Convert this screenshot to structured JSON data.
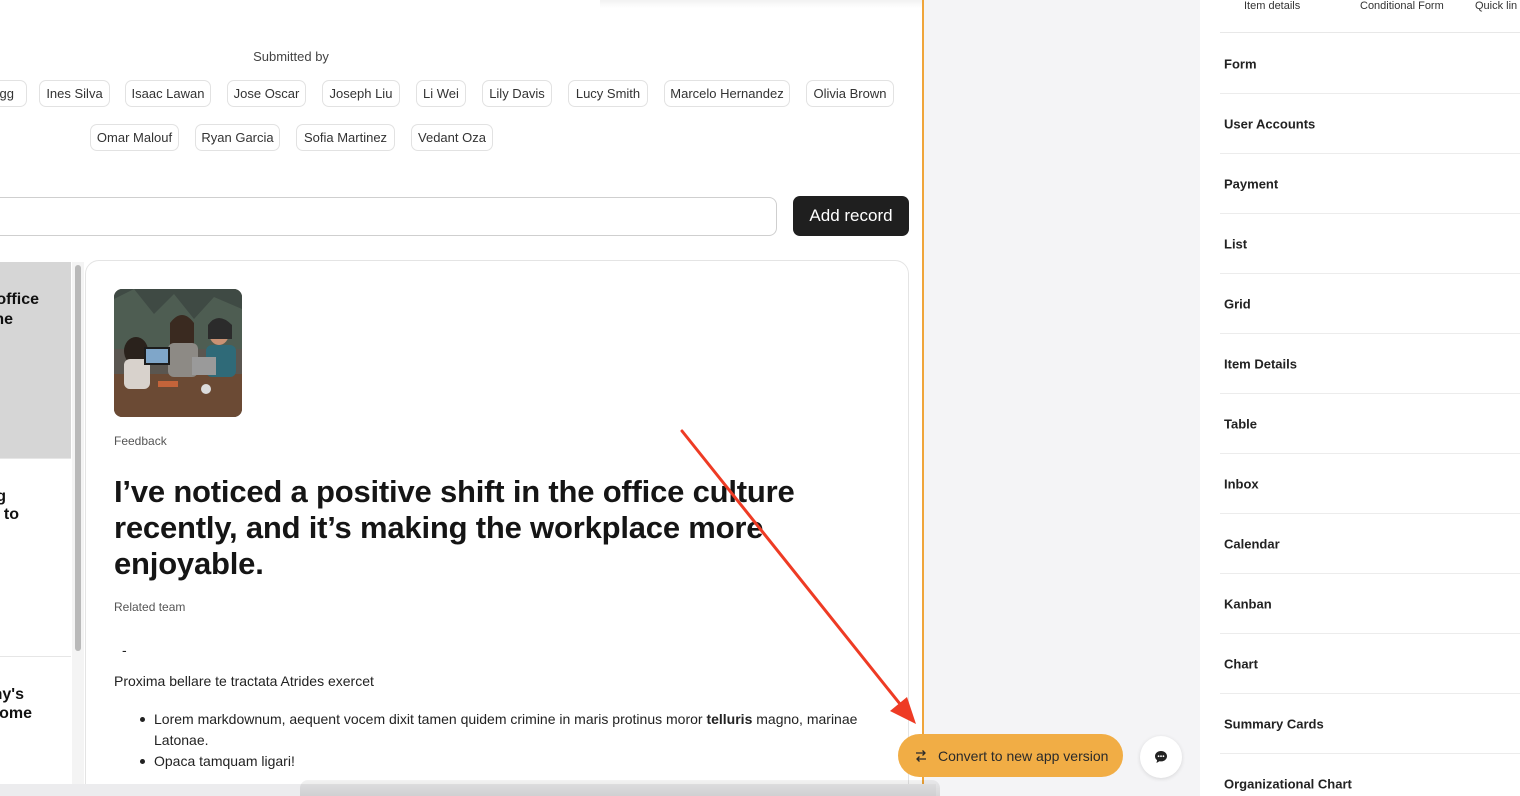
{
  "filter": {
    "label": "Submitted by",
    "chips_row1": [
      "Ligg",
      "Ines Silva",
      "Isaac Lawan",
      "Jose Oscar",
      "Joseph Liu",
      "Li Wei",
      "Lily Davis",
      "Lucy Smith",
      "Marcelo Hernandez",
      "Olivia Brown"
    ],
    "chips_row2": [
      "Omar Malouf",
      "Ryan Garcia",
      "Sofia Martinez",
      "Vedant Oza"
    ]
  },
  "search": {
    "value": ""
  },
  "add_record_label": "Add record",
  "list": {
    "cards": [
      {
        "line1": "office",
        "line2": "me"
      },
      {
        "line1": "g",
        "line2": "to"
      },
      {
        "line1": "ny's",
        "line2": "ome"
      }
    ]
  },
  "detail": {
    "photo_icon": "office-photo",
    "category_label": "Feedback",
    "headline": "I’ve noticed a positive shift in the office culture recently, and it’s making the workplace more enjoyable.",
    "related_team_label": "Related team",
    "related_team_value": "-",
    "paragraph": "Proxima bellare te tractata Atrides exercet",
    "bullet1_before": "Lorem markdownum, aequent vocem dixit tamen quidem crimine in maris protinus moror ",
    "bullet1_bold": "telluris",
    "bullet1_after": " magno, marinae Latonae.",
    "bullet2": "Opaca tamquam ligari!"
  },
  "convert_button": {
    "label": "Convert to new app version",
    "icon": "swap-icon"
  },
  "chat_button": {
    "icon": "chat-icon"
  },
  "sidebar": {
    "tabs": [
      "Item details",
      "Conditional Form",
      "Quick lin"
    ],
    "items": [
      "Form",
      "User Accounts",
      "Payment",
      "List",
      "Grid",
      "Item Details",
      "Table",
      "Inbox",
      "Calendar",
      "Kanban",
      "Chart",
      "Summary Cards",
      "Organizational Chart"
    ]
  },
  "colors": {
    "accent": "#f1ad45",
    "frame": "#f0a53a",
    "annotation_arrow": "#ee3b24",
    "primary_button": "#1f1f1f"
  }
}
